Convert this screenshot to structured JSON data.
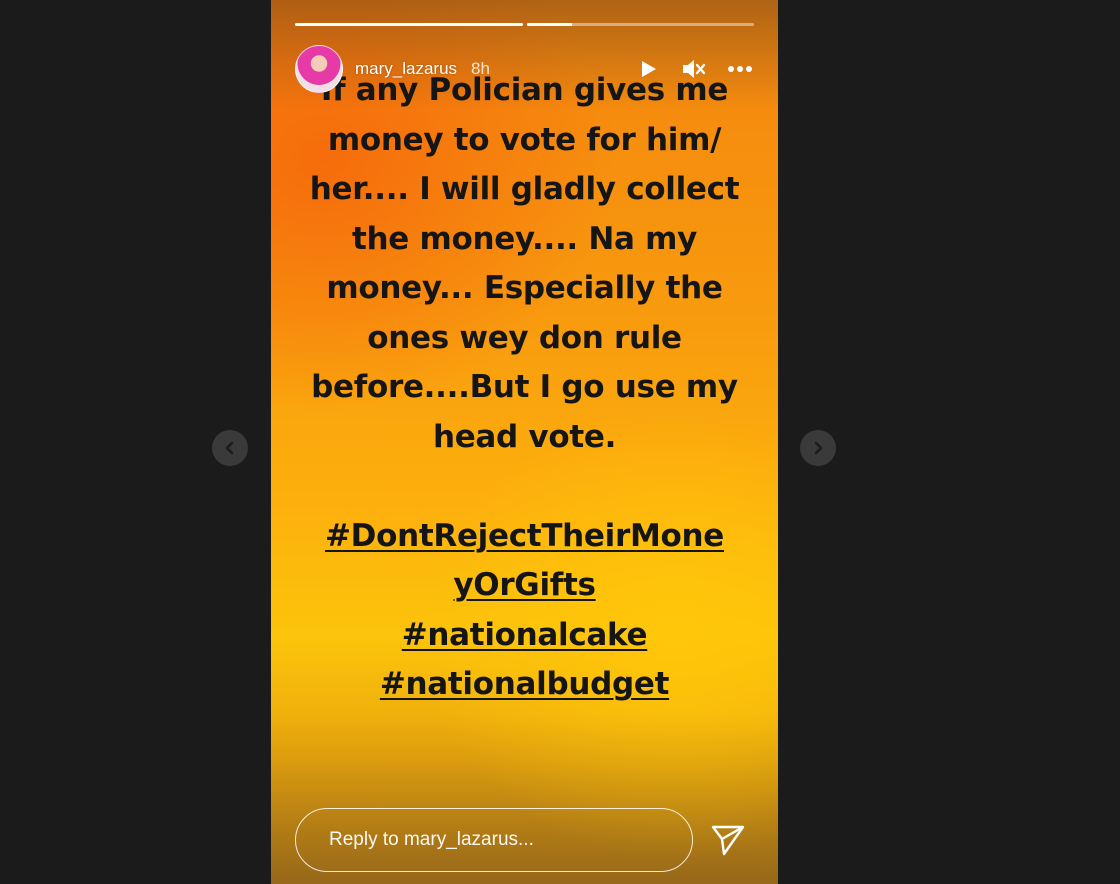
{
  "story": {
    "user": {
      "username": "mary_lazarus",
      "time": "8h"
    },
    "progress": [
      1.0,
      0.2
    ],
    "lines": [
      "If any Polician gives me",
      "money to vote for him/",
      "her.... I will gladly collect",
      "the money.... Na my",
      "money... Especially the",
      "ones wey don rule",
      "before....But I go use my",
      "head vote."
    ],
    "hashtags": [
      "#DontRejectTheirMone",
      "yOrGifts",
      "#nationalcake",
      "#nationalbudget"
    ],
    "reply_placeholder": "Reply to mary_lazarus..."
  },
  "icons": {
    "prev": "chevron-left-icon",
    "next": "chevron-right-icon",
    "play": "play-icon",
    "mute": "muted-speaker-icon",
    "more": "more-horizontal-icon",
    "send": "send-icon"
  }
}
